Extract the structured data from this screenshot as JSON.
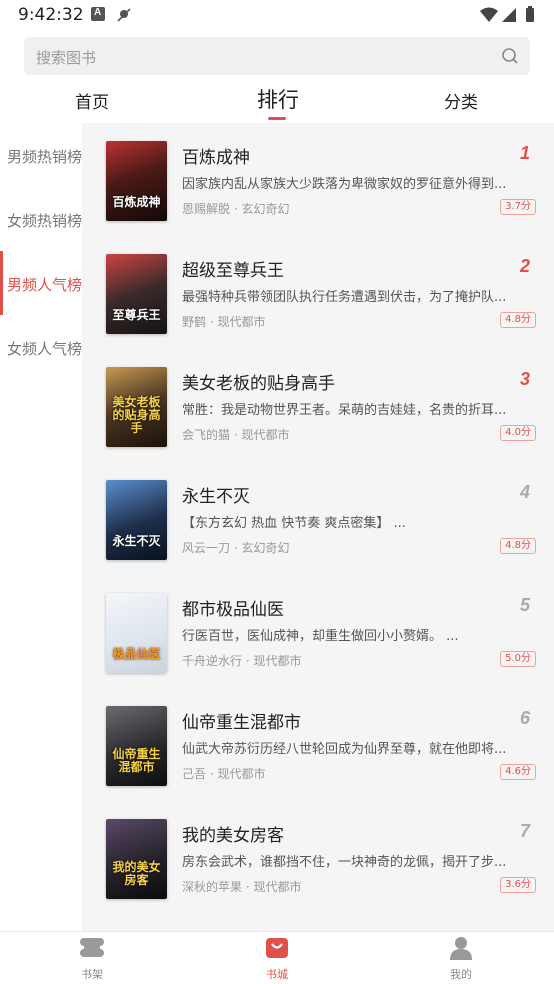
{
  "status_bar": {
    "time": "9:42:32"
  },
  "search": {
    "placeholder": "搜索图书"
  },
  "tabs": [
    {
      "label": "首页"
    },
    {
      "label": "排行"
    },
    {
      "label": "分类"
    }
  ],
  "categories": [
    {
      "label": "男频热销榜"
    },
    {
      "label": "女频热销榜"
    },
    {
      "label": "男频人气榜"
    },
    {
      "label": "女频人气榜"
    }
  ],
  "books": [
    {
      "rank": "1",
      "title": "百炼成神",
      "desc": "因家族内乱从家族大少跌落为卑微家奴的罗征意外得到...",
      "meta": "恩赐解脱 · 玄幻奇幻",
      "score": "3.7分",
      "cover_text": "百炼成神",
      "cover_color": "#4a1a16"
    },
    {
      "rank": "2",
      "title": "超级至尊兵王",
      "desc": "最强特种兵带领团队执行任务遭遇到伏击，为了掩护队...",
      "meta": "野鹤 · 现代都市",
      "score": "4.8分",
      "cover_text": "至尊兵王",
      "cover_color": "#3a2a2a"
    },
    {
      "rank": "3",
      "title": "美女老板的贴身高手",
      "desc": "常胜：我是动物世界王者。呆萌的吉娃娃，名贵的折耳...",
      "meta": "会飞的猫 · 现代都市",
      "score": "4.0分",
      "cover_text": "美女老板的贴身高手",
      "cover_color": "#4a3520"
    },
    {
      "rank": "4",
      "title": "永生不灭",
      "desc": "【东方玄幻 热血 快节奏 爽点密集】 ...",
      "meta": "风云一刀 · 玄幻奇幻",
      "score": "4.8分",
      "cover_text": "永生不灭",
      "cover_color": "#1e2f4a"
    },
    {
      "rank": "5",
      "title": "都市极品仙医",
      "desc": "行医百世，医仙成神，却重生做回小小赘婿。 ...",
      "meta": "千舟逆水行 · 现代都市",
      "score": "5.0分",
      "cover_text": "极品仙医",
      "cover_color": "#dfe6ee"
    },
    {
      "rank": "6",
      "title": "仙帝重生混都市",
      "desc": "仙武大帝苏衍历经八世轮回成为仙界至尊，就在他即将...",
      "meta": "己吾 · 现代都市",
      "score": "4.6分",
      "cover_text": "仙帝重生混都市",
      "cover_color": "#2a2a2e"
    },
    {
      "rank": "7",
      "title": "我的美女房客",
      "desc": "房东会武术，谁都挡不住，一块神奇的龙佩，揭开了步...",
      "meta": "深秋的苹果 · 现代都市",
      "score": "3.6分",
      "cover_text": "我的美女房客",
      "cover_color": "#26222a"
    }
  ],
  "bottom_nav": [
    {
      "label": "书架"
    },
    {
      "label": "书城"
    },
    {
      "label": "我的"
    }
  ],
  "colors": {
    "accent": "#e0514b",
    "panel_bg": "#f5f5f5"
  }
}
